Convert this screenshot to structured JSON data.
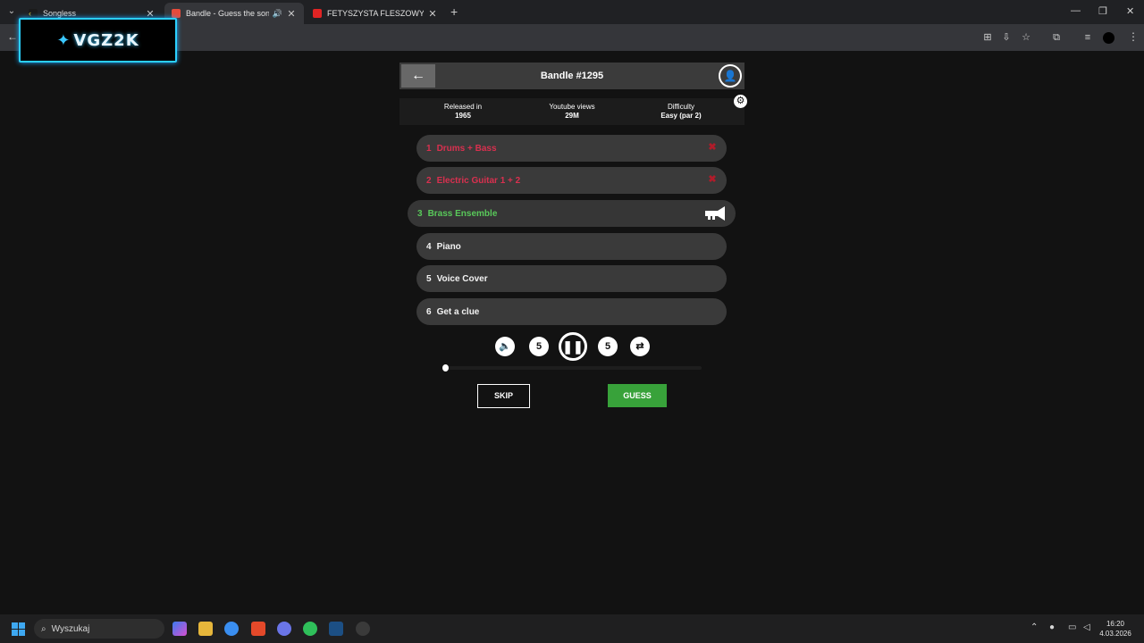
{
  "browser": {
    "tabs": [
      {
        "title": "Songless",
        "active": false
      },
      {
        "title": "Bandle - Guess the song, o",
        "active": true
      },
      {
        "title": "FETYSZYSTA FLESZOWY | CZY ...",
        "active": false
      }
    ],
    "new_tab_glyph": "+",
    "window_controls": [
      "—",
      "❐",
      "✕"
    ]
  },
  "overlay": {
    "logo_text": "VGZ2K"
  },
  "app": {
    "title": "Bandle #1295",
    "info": [
      {
        "label": "Released in",
        "value": "1965"
      },
      {
        "label": "Youtube views",
        "value": "29M"
      },
      {
        "label": "Difficulty",
        "value": "Easy (par 2)"
      }
    ],
    "stems": [
      {
        "num": "1",
        "label": "Drums + Bass",
        "state": "fail"
      },
      {
        "num": "2",
        "label": "Electric Guitar 1 + 2",
        "state": "fail"
      },
      {
        "num": "3",
        "label": "Brass Ensemble",
        "state": "active",
        "icon": "trumpet-icon"
      },
      {
        "num": "4",
        "label": "Piano",
        "state": "pending"
      },
      {
        "num": "5",
        "label": "Voice Cover",
        "state": "pending"
      },
      {
        "num": "6",
        "label": "Get a clue",
        "state": "pending"
      }
    ],
    "player": {
      "rewind_label": "5",
      "forward_label": "5",
      "progress": 0.0
    },
    "skip_label": "SKIP",
    "guess_label": "GUESS"
  },
  "taskbar": {
    "search_placeholder": "Wyszukaj",
    "time": "16:20",
    "date": "4.03.2026"
  },
  "colors": {
    "fail": "#d9304f",
    "active": "#59c95a",
    "guess_button": "#38a23a",
    "logo_border": "#2bd0ff"
  }
}
